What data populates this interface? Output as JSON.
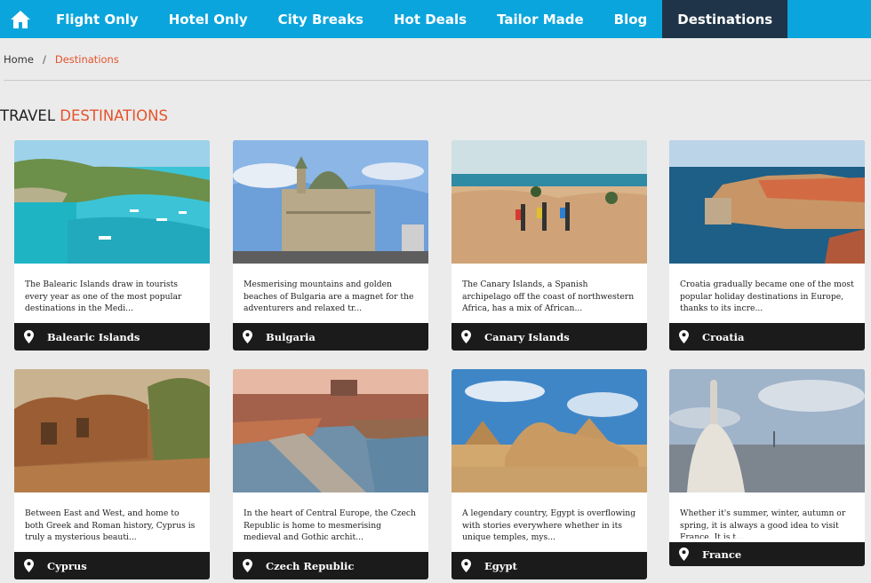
{
  "nav": {
    "home_icon": "home-icon",
    "items": [
      {
        "label": "Flight Only"
      },
      {
        "label": "Hotel Only"
      },
      {
        "label": "City Breaks"
      },
      {
        "label": "Hot Deals"
      },
      {
        "label": "Tailor Made"
      },
      {
        "label": "Blog"
      },
      {
        "label": "Destinations",
        "active": true
      }
    ]
  },
  "breadcrumb": {
    "home": "Home",
    "separator": "/",
    "current": "Destinations"
  },
  "title": {
    "prefix": "TRAVEL ",
    "accent": "DESTINATIONS"
  },
  "colors": {
    "nav_bg": "#0aa5dd",
    "nav_active": "#1f3448",
    "accent": "#e5532d",
    "card_bar": "#1b1b1b"
  },
  "destinations": [
    {
      "name": "Balearic Islands",
      "text": "The Balearic Islands draw in tourists every year as one of the most popular destinations in the Medi...",
      "icon": "location-pin-icon"
    },
    {
      "name": "Bulgaria",
      "text": "Mesmerising mountains and golden beaches of Bulgaria are a magnet for the adventurers and relaxed tr...",
      "icon": "location-pin-icon"
    },
    {
      "name": "Canary Islands",
      "text": "The Canary Islands, a Spanish archipelago off the coast of northwestern Africa, has a mix of African...",
      "icon": "location-pin-icon"
    },
    {
      "name": "Croatia",
      "text": "Croatia gradually became one of the most popular holiday destinations in Europe, thanks to its incre...",
      "icon": "location-pin-icon"
    },
    {
      "name": "Cyprus",
      "text": "Between East and West, and home to both Greek and Roman history, Cyprus is truly a mysterious beauti...",
      "icon": "location-pin-icon"
    },
    {
      "name": "Czech Republic",
      "text": "In the heart of Central Europe, the Czech Republic is home to mesmerising medieval and Gothic archit...",
      "icon": "location-pin-icon"
    },
    {
      "name": "Egypt",
      "text": "A legendary country, Egypt is overflowing with stories everywhere whether in its unique temples, mys...",
      "icon": "location-pin-icon"
    },
    {
      "name": "France",
      "text": "Whether it's summer, winter, autumn or spring, it is always a good idea to visit France. It is t...",
      "icon": "location-pin-icon"
    }
  ]
}
